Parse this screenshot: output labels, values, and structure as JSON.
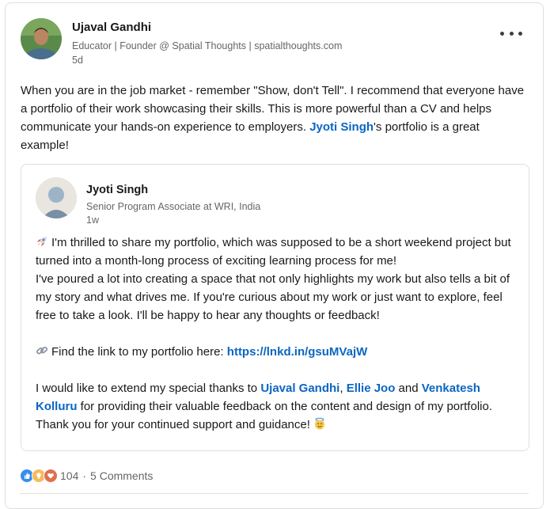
{
  "author": {
    "name": "Ujaval Gandhi",
    "headline": "Educator | Founder @ Spatial Thoughts | spatialthoughts.com",
    "time": "5d"
  },
  "post": {
    "text_before": "When you are in the job market - remember \"Show, don't Tell\". I recommend that everyone have a portfolio of their work showcasing their skills. This is more powerful than a CV and helps communicate your hands-on experience to employers. ",
    "mention": "Jyoti Singh",
    "text_after": "'s portfolio is a great example!"
  },
  "shared_post": {
    "author": {
      "name": "Jyoti Singh",
      "headline": "Senior Program Associate at WRI, India",
      "time": "1w"
    },
    "p1": "I'm thrilled to share my portfolio, which was supposed to be a short weekend project but turned into a month-long process of exciting learning process for me!",
    "p2": "I've poured a lot into creating a space that not only highlights my work but also tells a bit of my story and what drives me. If you're curious about my work or just want to explore, feel free to take a look. I'll be happy to hear any thoughts or feedback!",
    "link_prefix": "Find the link to my portfolio here: ",
    "link": "https://lnkd.in/gsuMVajW",
    "thanks_prefix": "I would like to extend my special thanks to ",
    "mention1": "Ujaval Gandhi",
    "sep1": ", ",
    "mention2": "Ellie Joo",
    "sep2": " and ",
    "mention3": "Venkatesh Kolluru",
    "thanks_suffix": " for providing their valuable feedback on the content and design of my portfolio. Thank you for your continued support and guidance!"
  },
  "social": {
    "reaction_count": "104",
    "separator": "·",
    "comments": "5 Comments"
  },
  "icons": {
    "more": "more-options-icon",
    "rocket": "rocket-emoji-icon",
    "link": "link-emoji-icon",
    "smile": "smiling-face-halo-emoji-icon",
    "like": "like-reaction-icon",
    "insightful": "insightful-reaction-icon",
    "love": "love-reaction-icon"
  },
  "colors": {
    "link": "#0a66c2",
    "muted": "#666666",
    "like": "#378fe9",
    "insightful": "#f5bb5c",
    "love": "#df704d"
  }
}
